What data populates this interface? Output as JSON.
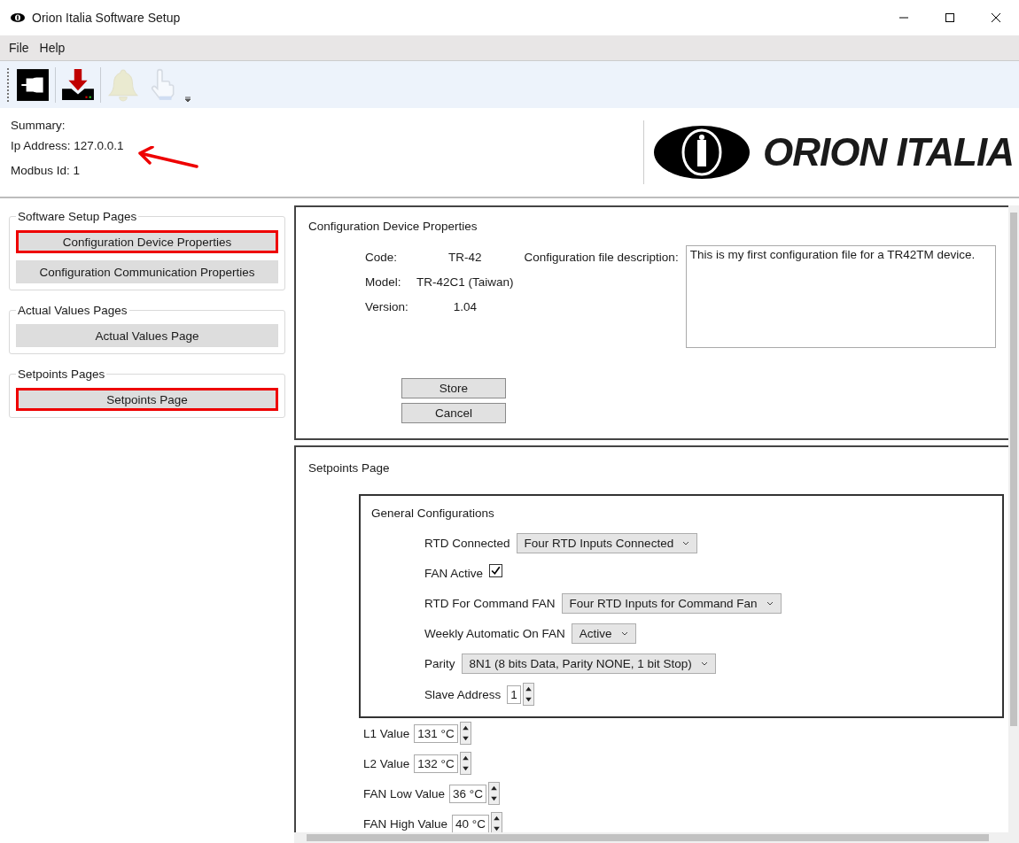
{
  "window": {
    "title": "Orion Italia Software Setup"
  },
  "menu": [
    "File",
    "Help"
  ],
  "toolbar": [
    {
      "kind": "connect",
      "disabled": false
    },
    {
      "kind": "download",
      "disabled": false
    },
    {
      "kind": "bell",
      "disabled": true
    },
    {
      "kind": "hand",
      "disabled": true
    }
  ],
  "summary": {
    "title": "Summary:",
    "lines": [
      {
        "text": "Ip Address: 127.0.0.1",
        "annotated": true
      },
      {
        "text": "Modbus Id: 1",
        "annotated": false
      }
    ]
  },
  "logo": {
    "text": "ORION ITALIA"
  },
  "sidebar": [
    {
      "title": "Software Setup Pages",
      "buttons": [
        {
          "label": "Configuration Device Properties",
          "highlighted": true
        },
        {
          "label": "Configuration Communication Properties",
          "highlighted": false
        }
      ]
    },
    {
      "title": "Actual Values Pages",
      "buttons": [
        {
          "label": "Actual Values Page",
          "highlighted": false
        }
      ]
    },
    {
      "title": "Setpoints Pages",
      "buttons": [
        {
          "label": "Setpoints Page",
          "highlighted": true
        }
      ]
    }
  ],
  "device": {
    "title": "Configuration Device Properties",
    "fields": [
      {
        "label": "Code:",
        "value": "TR-42"
      },
      {
        "label": "Model:",
        "value": "TR-42C1 (Taiwan)"
      },
      {
        "label": "Version:",
        "value": "1.04"
      }
    ],
    "description_label": "Configuration file description:",
    "description": "This is my first configuration file for a TR42TM device.",
    "buttons": [
      "Store",
      "Cancel"
    ]
  },
  "setpoints": {
    "title": "Setpoints Page",
    "general": {
      "title": "General Configurations",
      "rows": [
        {
          "kind": "dropdown",
          "label": "RTD Connected",
          "value": "Four RTD Inputs Connected"
        },
        {
          "kind": "checkbox",
          "label": "FAN Active",
          "checked": true
        },
        {
          "kind": "dropdown",
          "label": "RTD For Command FAN",
          "value": "Four RTD Inputs for Command Fan"
        },
        {
          "kind": "dropdown",
          "label": "Weekly Automatic On FAN",
          "value": "Active"
        },
        {
          "kind": "dropdown",
          "label": "Parity",
          "value": "8N1 (8 bits Data, Parity NONE, 1 bit Stop)"
        },
        {
          "kind": "spinner",
          "label": "Slave Address",
          "value": "1"
        }
      ]
    },
    "values": [
      {
        "label": "L1 Value",
        "value": "131 °C"
      },
      {
        "label": "L2 Value",
        "value": "132 °C"
      },
      {
        "label": "FAN Low Value",
        "value": "36 °C"
      },
      {
        "label": "FAN High Value",
        "value": "40 °C"
      }
    ]
  }
}
